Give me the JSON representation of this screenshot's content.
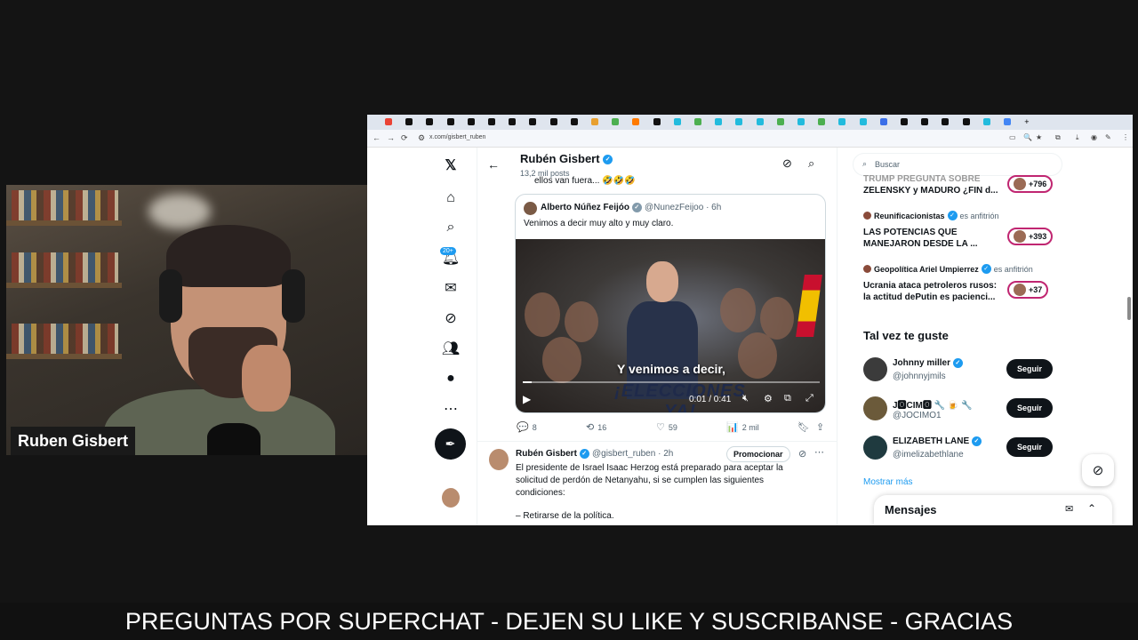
{
  "webcam": {
    "name_label": "Ruben Gisbert"
  },
  "browser": {
    "tab_favicons": [
      "#ea4335",
      "#111",
      "#111",
      "#111",
      "#111",
      "#111",
      "#111",
      "#111",
      "#111",
      "#111",
      "#e8a030",
      "#4caf50",
      "#ff7a00",
      "#111",
      "#2bd",
      "#4caf50",
      "#2bd",
      "#2bd",
      "#2bd",
      "#4caf50",
      "#2bd",
      "#4caf50",
      "#2bd",
      "#2bd",
      "#3a6ee8",
      "#111",
      "#111",
      "#111",
      "#111",
      "#2bd",
      "#4285f4"
    ],
    "new_tab": "+",
    "url": "x.com/gisbert_ruben"
  },
  "x_sidebar": {
    "notif_badge": "20+"
  },
  "profile_header": {
    "name": "Rubén Gisbert",
    "posts_count": "13,2 mil posts",
    "back_icon": "←",
    "prev_post_text": "ellos van fuera... 🤣🤣🤣"
  },
  "quoted_post": {
    "author": "Alberto Núñez Feijóo",
    "handle": "@NunezFeijoo · 6h",
    "text": "Venimos a decir muy alto y muy claro.",
    "video": {
      "caption": "Y venimos a decir,",
      "banner": "¡ELECCIONES YA!",
      "time": "0:01 / 0:41",
      "progress": 0.03
    }
  },
  "post_actions": [
    {
      "icon": "💬",
      "value": "8"
    },
    {
      "icon": "⟲",
      "value": "16"
    },
    {
      "icon": "♡",
      "value": "59"
    },
    {
      "icon": "📊",
      "value": "2 mil"
    }
  ],
  "post2": {
    "author": "Rubén Gisbert",
    "handle": "@gisbert_ruben · 2h",
    "promote": "Promocionar",
    "lines": [
      "El presidente de Israel Isaac Herzog está preparado para aceptar la",
      "solicitud de perdón de Netanyahu, si se cumplen las siguientes",
      "condiciones:",
      "",
      "– Retirarse de la política."
    ]
  },
  "right_col": {
    "search_placeholder": "Buscar",
    "spaces": [
      {
        "host": "",
        "sub": "",
        "title_line1": "TRUMP PREGUNTA SOBRE",
        "title_line2": "ZELENSKY y MADURO ¿FIN d...",
        "count": "+796"
      },
      {
        "host": "Reunificacionistas",
        "sub": "es anfitrión",
        "title_line1": "LAS POTENCIAS QUE",
        "title_line2": "MANEJARON DESDE LA ...",
        "count": "+393"
      },
      {
        "host": "Geopolítica Ariel Umpierrez",
        "sub": "es anfitrión",
        "title_line1": "Ucrania ataca petroleros rusos:",
        "title_line2": "la actitud dePutin es pacienci...",
        "count": "+37"
      }
    ],
    "suggest_title": "Tal vez te guste",
    "suggestions": [
      {
        "name": "Johnny miller",
        "handle": "@johnnyjmils",
        "follow": "Seguir"
      },
      {
        "name": "J🅾CIM🅾 🔧 🍺 🔧",
        "handle": "@JOCIMO1",
        "follow": "Seguir"
      },
      {
        "name": "ELIZABETH LANE",
        "handle": "@imelizabethlane",
        "follow": "Seguir"
      }
    ],
    "show_more": "Mostrar más",
    "messages_title": "Mensajes"
  },
  "ticker": {
    "text": "PREGUNTAS POR SUPERCHAT - DEJEN SU LIKE Y SUSCRIBANSE - GRACIAS"
  }
}
